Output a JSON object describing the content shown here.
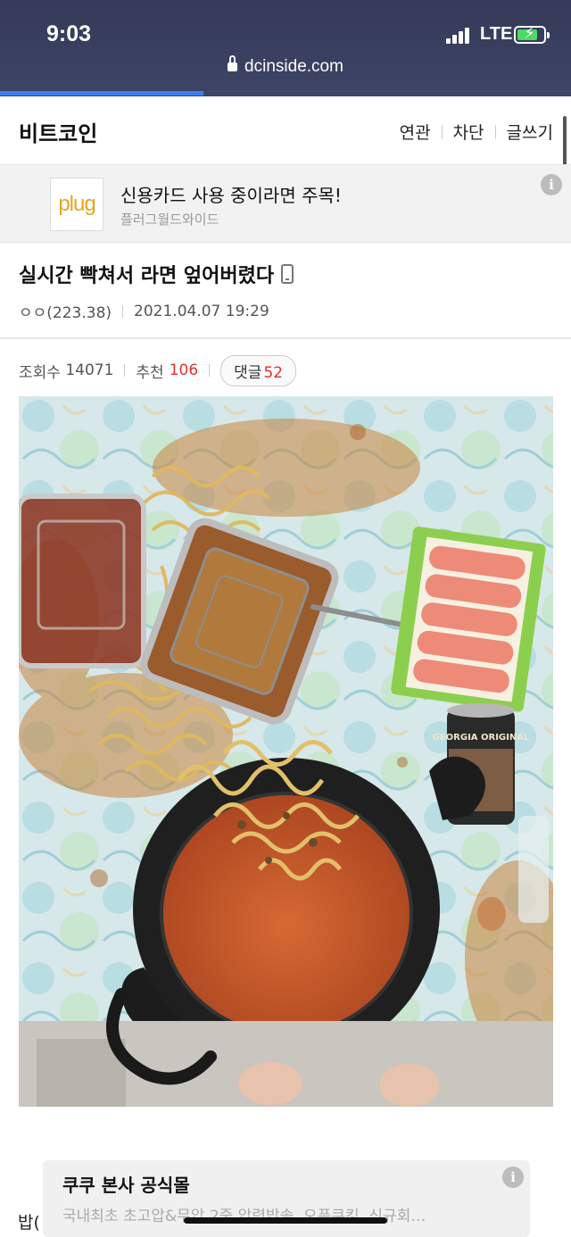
{
  "status_bar": {
    "time": "9:03",
    "network": "LTE"
  },
  "browser": {
    "url": "dcinside.com"
  },
  "header": {
    "title": "비트코인",
    "links": [
      "연관",
      "차단",
      "글쓰기"
    ]
  },
  "ad_banner": {
    "logo_text": "plug",
    "headline": "신용카드 사용 중이라면 주목!",
    "advertiser": "플러그월드와이드"
  },
  "post": {
    "title": "실시간 빡쳐서 라면 엎어버렸다",
    "author": "ㅇㅇ(223.38)",
    "date": "2021.04.07 19:29",
    "views_label": "조회수",
    "views": "14071",
    "recommend_label": "추천",
    "recommend": "106",
    "comments_label": "댓글",
    "comments": "52"
  },
  "photo": {
    "can_label": "GEORGIA ORIGINAL"
  },
  "body_text_fragment": "밥(",
  "bottom_ad": {
    "title": "쿠쿠 본사 공식몰",
    "description": "국내최초 초고압&무압 2중 압력밥솥, 오픈쿠킹, 신규회…"
  },
  "colors": {
    "status_bar_bg": "#3a4062",
    "progress": "#3d7ff2",
    "count_red": "#d33333"
  }
}
